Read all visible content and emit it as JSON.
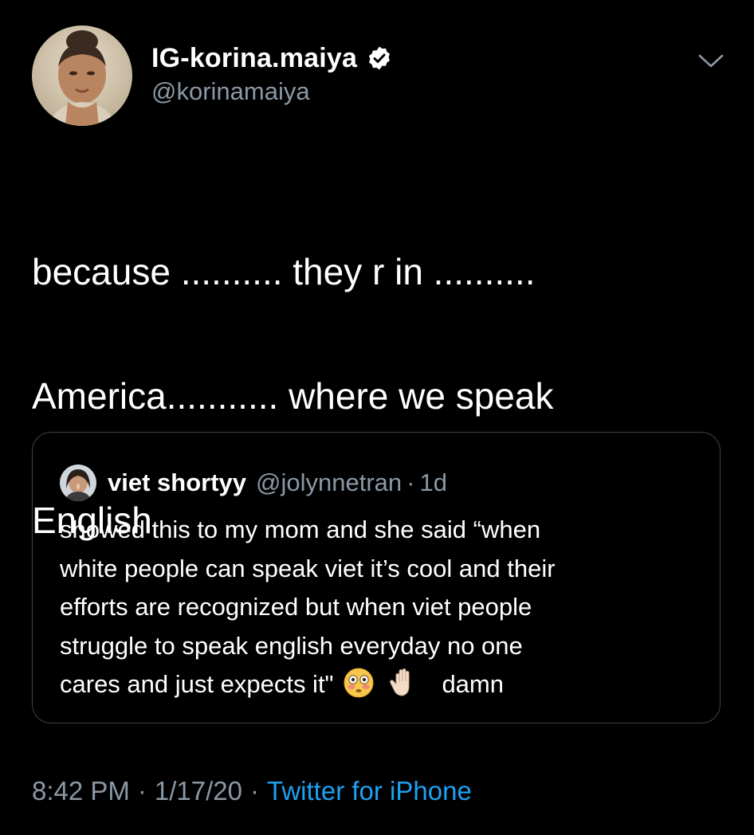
{
  "author": {
    "display_name": "IG-korina.maiya",
    "handle": "@korinamaiya",
    "verified": true
  },
  "tweet": {
    "lines": [
      "because .......... they r in ..........",
      "America........... where we speak",
      "English"
    ]
  },
  "quote": {
    "name": "viet shortyy",
    "handle": "@jolynnetran",
    "separator": "·",
    "time": "1d",
    "lines": [
      "showed this to my mom and she said “when",
      "white people can speak viet it’s cool and their",
      "efforts are recognized but when viet people",
      "struggle to speak english everyday no one"
    ],
    "last_line_text": "cares and just expects it\"",
    "emojis": [
      "flushed-face-emoji",
      "raised-hand-emoji"
    ],
    "last_word": "damn"
  },
  "meta": {
    "time": "8:42 PM",
    "sep": "·",
    "date": "1/17/20",
    "source": "Twitter for iPhone"
  },
  "icons": {
    "verified": "verified-badge-icon",
    "menu": "chevron-down-icon"
  },
  "colors": {
    "background": "#000000",
    "text": "#ffffff",
    "secondary": "#8b98a5",
    "link": "#1da1f2",
    "border": "#38444d"
  }
}
